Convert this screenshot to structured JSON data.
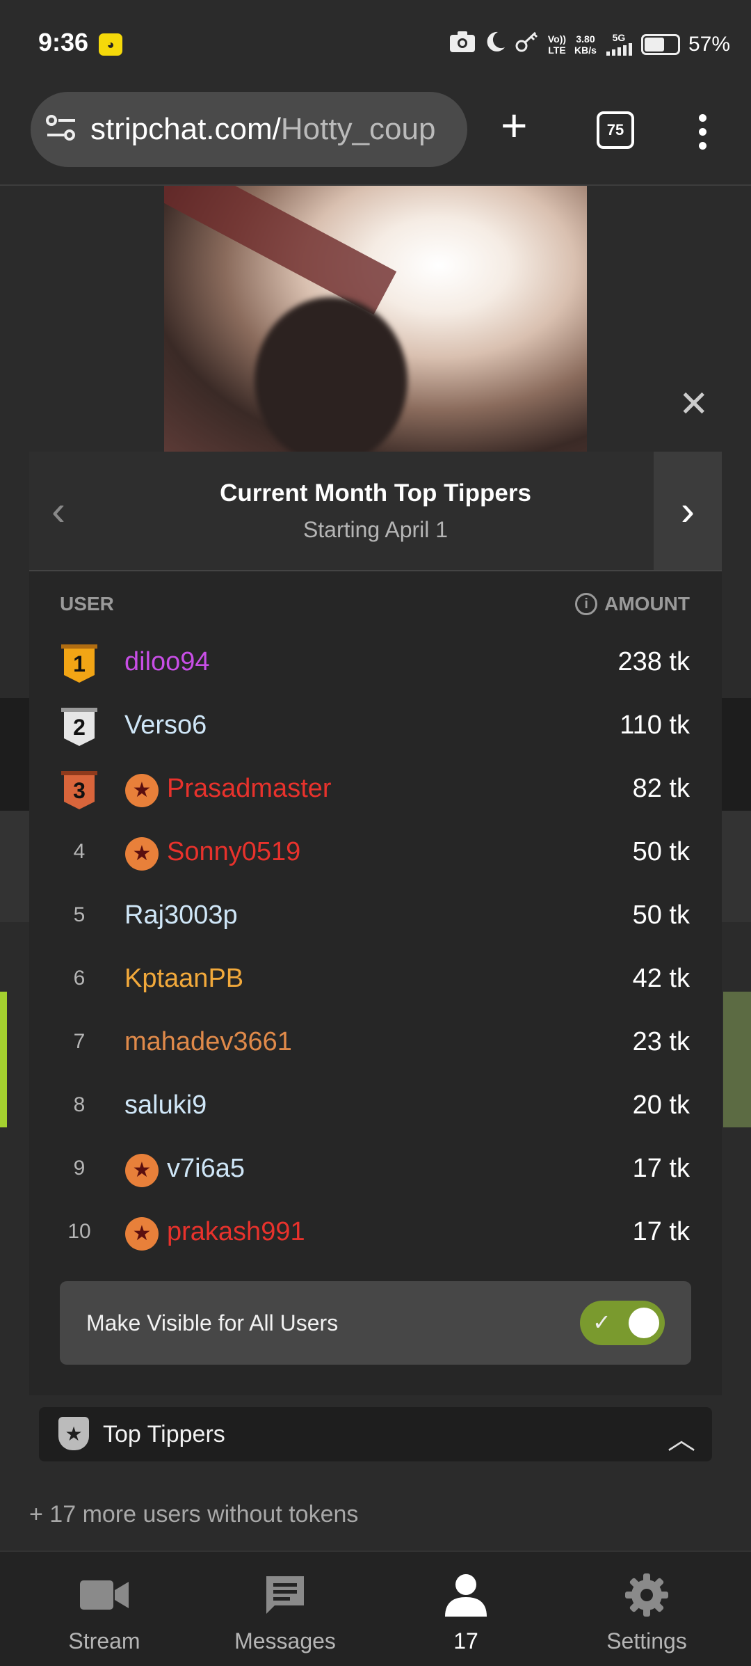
{
  "status_bar": {
    "time": "9:36",
    "network_speed": "3.80",
    "network_speed_unit": "KB/s",
    "network_type": "5G",
    "volte_top": "Vo))",
    "volte_bottom": "LTE",
    "battery": "57%"
  },
  "browser": {
    "url_domain": "stripchat.com/",
    "url_path": "Hotty_coup",
    "tab_count": "75"
  },
  "modal": {
    "title": "Current Month Top Tippers",
    "subtitle": "Starting April 1",
    "col_user": "USER",
    "col_amount": "AMOUNT",
    "rows": [
      {
        "rank": "1",
        "name": "diloo94",
        "amount": "238 tk",
        "color": "#c84ee6"
      },
      {
        "rank": "2",
        "name": "Verso6",
        "amount": "110 tk",
        "color": "#cfe6f7"
      },
      {
        "rank": "3",
        "name": "Prasadmaster",
        "amount": "82 tk",
        "color": "#e8322c"
      },
      {
        "rank": "4",
        "name": "Sonny0519",
        "amount": "50 tk",
        "color": "#e8322c"
      },
      {
        "rank": "5",
        "name": "Raj3003p",
        "amount": "50 tk",
        "color": "#cfe6f7"
      },
      {
        "rank": "6",
        "name": "KptaanPB",
        "amount": "42 tk",
        "color": "#f2a93b"
      },
      {
        "rank": "7",
        "name": "mahadev3661",
        "amount": "23 tk",
        "color": "#e08a4a"
      },
      {
        "rank": "8",
        "name": "saluki9",
        "amount": "20 tk",
        "color": "#cfe6f7"
      },
      {
        "rank": "9",
        "name": "v7i6a5",
        "amount": "17 tk",
        "color": "#cfe6f7"
      },
      {
        "rank": "10",
        "name": "prakash991",
        "amount": "17 tk",
        "color": "#e8322c"
      }
    ],
    "visible_label": "Make Visible for All Users",
    "visible_toggle_on": true
  },
  "top_tippers_label": "Top Tippers",
  "more_users": "+ 17 more users without tokens",
  "bottom_nav": {
    "stream": "Stream",
    "messages": "Messages",
    "users": "17",
    "settings": "Settings"
  },
  "colors": {
    "toggle_on": "#7a9a2e",
    "gold": "#f2a515",
    "silver": "#e6e6e6",
    "bronze": "#d9653b"
  }
}
